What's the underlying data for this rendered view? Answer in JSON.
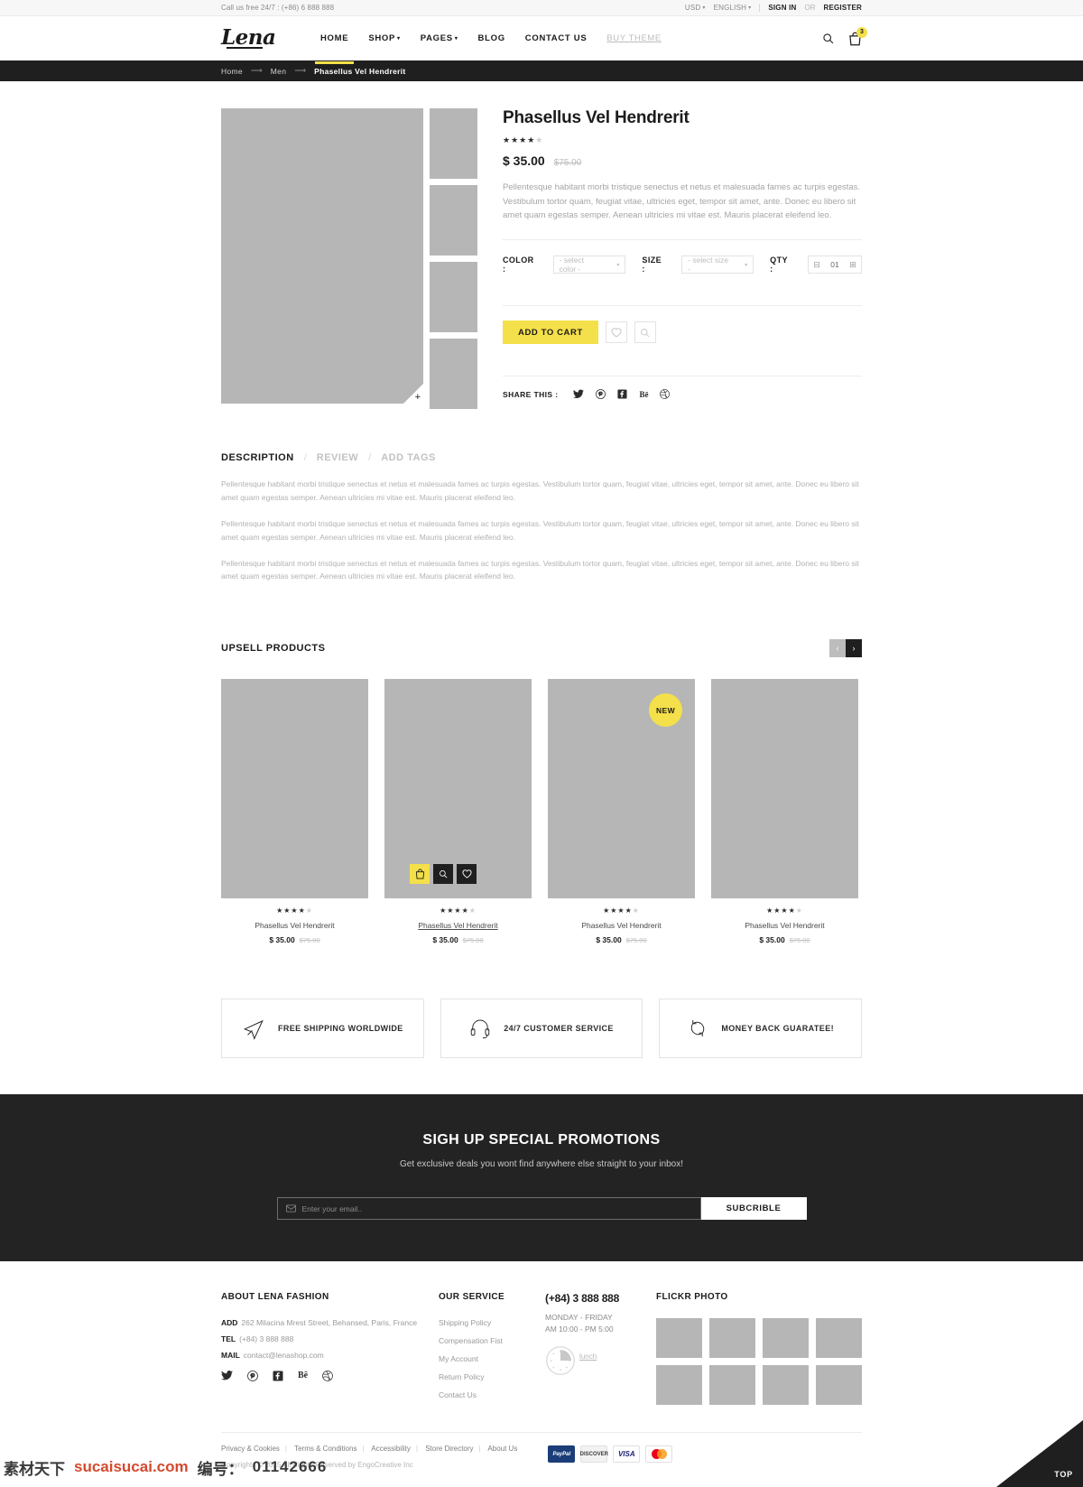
{
  "topbar": {
    "phone_text": "Call us free 24/7 : (+86) 6 888 888",
    "currency": "USD",
    "language": "ENGLISH",
    "signin": "SIGN IN",
    "or": "OR",
    "register": "REGISTER"
  },
  "header": {
    "logo": "Lena",
    "nav": [
      {
        "label": "HOME",
        "state": "active"
      },
      {
        "label": "SHOP",
        "state": "dropdown"
      },
      {
        "label": "PAGES",
        "state": "dropdown"
      },
      {
        "label": "BLOG",
        "state": "normal"
      },
      {
        "label": "CONTACT US",
        "state": "normal"
      },
      {
        "label": "BUY THEME",
        "state": "muted"
      }
    ],
    "cart_count": "3"
  },
  "breadcrumb": {
    "home": "Home",
    "category": "Men",
    "current": "Phasellus Vel Hendrerit"
  },
  "product": {
    "title": "Phasellus Vel Hendrerit",
    "rating": 4,
    "rating_max": 5,
    "price": "$ 35.00",
    "price_old": "$75.00",
    "description": "Pellentesque habitant morbi tristique senectus et netus et malesuada fames ac turpis egestas. Vestibulum tortor quam, feugiat vitae, ultricies eget, tempor sit amet, ante. Donec eu libero sit amet quam egestas semper. Aenean ultricies mi vitae est. Mauris placerat eleifend leo.",
    "color_label": "COLOR :",
    "color_value": "- select color -",
    "size_label": "SIZE :",
    "size_value": "- select size -",
    "qty_label": "QTY :",
    "qty_value": "01",
    "add_to_cart": "ADD TO CART",
    "share_label": "SHARE THIS :",
    "share_icons": [
      "twitter-icon",
      "pinterest-icon",
      "facebook-icon",
      "behance-icon",
      "dribbble-icon"
    ]
  },
  "tabs": {
    "items": [
      {
        "label": "DESCRIPTION",
        "active": true
      },
      {
        "label": "REVIEW",
        "active": false
      },
      {
        "label": "ADD TAGS",
        "active": false
      }
    ],
    "separator": "/",
    "paragraphs": [
      "Pellentesque habitant morbi tristique senectus et netus et malesuada fames ac turpis egestas. Vestibulum tortor quam, feugiat vitae, ultricies eget, tempor sit amet, ante. Donec eu libero sit amet quam egestas semper. Aenean ultricies mi vitae est. Mauris placerat eleifend leo.",
      "Pellentesque habitant morbi tristique senectus et netus et malesuada fames ac turpis egestas. Vestibulum tortor quam, feugiat vitae, ultricies eget, tempor sit amet, ante. Donec eu libero sit amet quam egestas semper. Aenean ultricies mi vitae est. Mauris placerat eleifend leo.",
      "Pellentesque habitant morbi tristique senectus et netus et malesuada fames ac turpis egestas. Vestibulum tortor quam, feugiat vitae, ultricies eget, tempor sit amet, ante. Donec eu libero sit amet quam egestas semper. Aenean ultricies mi vitae est. Mauris placerat eleifend leo."
    ]
  },
  "upsell": {
    "title": "UPSELL PRODUCTS",
    "products": [
      {
        "name": "Phasellus Vel Hendrerit",
        "price": "$ 35.00",
        "price_old": "$75.00",
        "rating": 4,
        "badge": "",
        "hovered": false,
        "underline": false
      },
      {
        "name": "Phasellus Vel Hendrerit",
        "price": "$ 35.00",
        "price_old": "$75.00",
        "rating": 4,
        "badge": "",
        "hovered": true,
        "underline": true
      },
      {
        "name": "Phasellus Vel Hendrerit",
        "price": "$ 35.00",
        "price_old": "$75.00",
        "rating": 4,
        "badge": "NEW",
        "hovered": false,
        "underline": false
      },
      {
        "name": "Phasellus Vel Hendrerit",
        "price": "$ 35.00",
        "price_old": "$75.00",
        "rating": 4,
        "badge": "",
        "hovered": false,
        "underline": false
      }
    ]
  },
  "features": [
    {
      "icon": "airplane-icon",
      "label": "FREE SHIPPING WORLDWIDE"
    },
    {
      "icon": "headset-icon",
      "label": "24/7 CUSTOMER SERVICE"
    },
    {
      "icon": "refresh-icon",
      "label": "MONEY BACK GUARATEE!"
    }
  ],
  "newsletter": {
    "heading": "SIGH UP SPECIAL PROMOTIONS",
    "subheading": "Get exclusive deals you wont find anywhere else straight to your inbox!",
    "placeholder": "Enter your email..",
    "button": "SUBCRIBLE"
  },
  "footer": {
    "about": {
      "heading": "ABOUT LENA FASHION",
      "add_label": "ADD",
      "add_value": "262 Milacina Mrest Street, Behansed, Paris, France",
      "tel_label": "TEL",
      "tel_value": "(+84) 3 888 888",
      "mail_label": "MAIL",
      "mail_value": "contact@lenashop.com",
      "socials": [
        "twitter-icon",
        "pinterest-icon",
        "facebook-icon",
        "behance-icon",
        "dribbble-icon"
      ]
    },
    "service": {
      "heading": "OUR SERVICE",
      "links": [
        "Shipping Policy",
        "Compensation Fist",
        "My Account",
        "Return Policy",
        "Contact Us"
      ]
    },
    "contact": {
      "phone": "(+84) 3 888 888",
      "days": "MONDAY - FRIDAY",
      "hours": "AM 10:00 - PM 5:00",
      "lunch": "lunch"
    },
    "flickr": {
      "heading": "FLICKR PHOTO",
      "thumb_count": 8
    },
    "bottom_links": [
      "Privacy & Cookies",
      "Terms & Conditions",
      "Accessibility",
      "Store Directory",
      "About Us"
    ],
    "copyright": "Copyrights © 2015 All Rights Reserved by EngoCreative Inc",
    "payments": [
      "PayPal",
      "DISCOVER",
      "VISA",
      "mastercard"
    ]
  },
  "watermark": {
    "cn": "素材天下",
    "url": "sucaisucai.com",
    "label": "编号：",
    "number": "01142666"
  },
  "top_button": "TOP",
  "colors": {
    "accent": "#f4e04a",
    "dark": "#1f1f1f",
    "placeholder_gray": "#b6b6b6"
  }
}
